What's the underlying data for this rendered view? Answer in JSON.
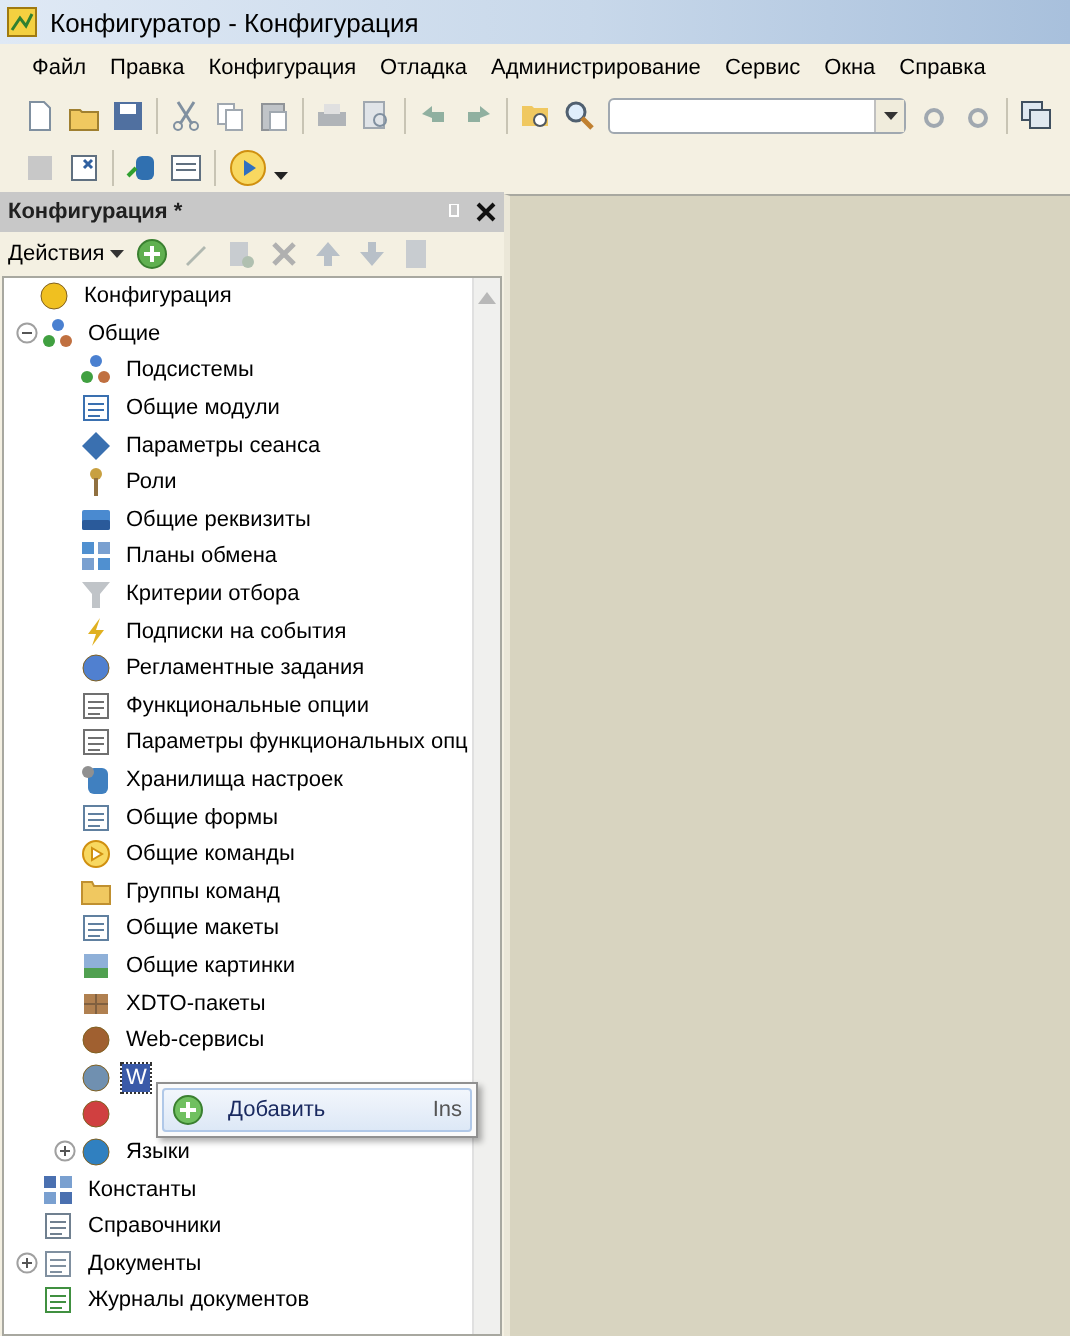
{
  "window": {
    "title": "Конфигуратор - Конфигурация"
  },
  "menu": [
    "Файл",
    "Правка",
    "Конфигурация",
    "Отладка",
    "Администрирование",
    "Сервис",
    "Окна",
    "Справка"
  ],
  "panel": {
    "title": "Конфигурация *",
    "actions": "Действия"
  },
  "tree": [
    {
      "label": "Конфигурация",
      "selected": false,
      "children": [
        {
          "label": "Общие",
          "selected": false,
          "expanded": true,
          "children": [
            {
              "label": "Подсистемы",
              "selected": false
            },
            {
              "label": "Общие модули",
              "selected": false
            },
            {
              "label": "Параметры сеанса",
              "selected": false
            },
            {
              "label": "Роли",
              "selected": false
            },
            {
              "label": "Общие реквизиты",
              "selected": false
            },
            {
              "label": "Планы обмена",
              "selected": false
            },
            {
              "label": "Критерии отбора",
              "selected": false
            },
            {
              "label": "Подписки на события",
              "selected": false
            },
            {
              "label": "Регламентные задания",
              "selected": false
            },
            {
              "label": "Функциональные опции",
              "selected": false
            },
            {
              "label": "Параметры функциональных опц",
              "selected": false
            },
            {
              "label": "Хранилища настроек",
              "selected": false
            },
            {
              "label": "Общие формы",
              "selected": false
            },
            {
              "label": "Общие команды",
              "selected": false
            },
            {
              "label": "Группы команд",
              "selected": false
            },
            {
              "label": "Общие макеты",
              "selected": false
            },
            {
              "label": "Общие картинки",
              "selected": false
            },
            {
              "label": "XDTO-пакеты",
              "selected": false
            },
            {
              "label": "Web-сервисы",
              "selected": false
            },
            {
              "label": "W",
              "selected": true
            },
            {
              "selected": false
            },
            {
              "label": "Языки",
              "selected": false,
              "expanded": false
            }
          ]
        },
        {
          "label": "Константы",
          "selected": false
        },
        {
          "label": "Справочники",
          "selected": false
        },
        {
          "label": "Документы",
          "selected": false,
          "expanded": false
        },
        {
          "label": "Журналы документов",
          "selected": false
        }
      ]
    }
  ],
  "context_menu": [
    {
      "label": "Добавить",
      "shortcut": "Ins"
    }
  ]
}
